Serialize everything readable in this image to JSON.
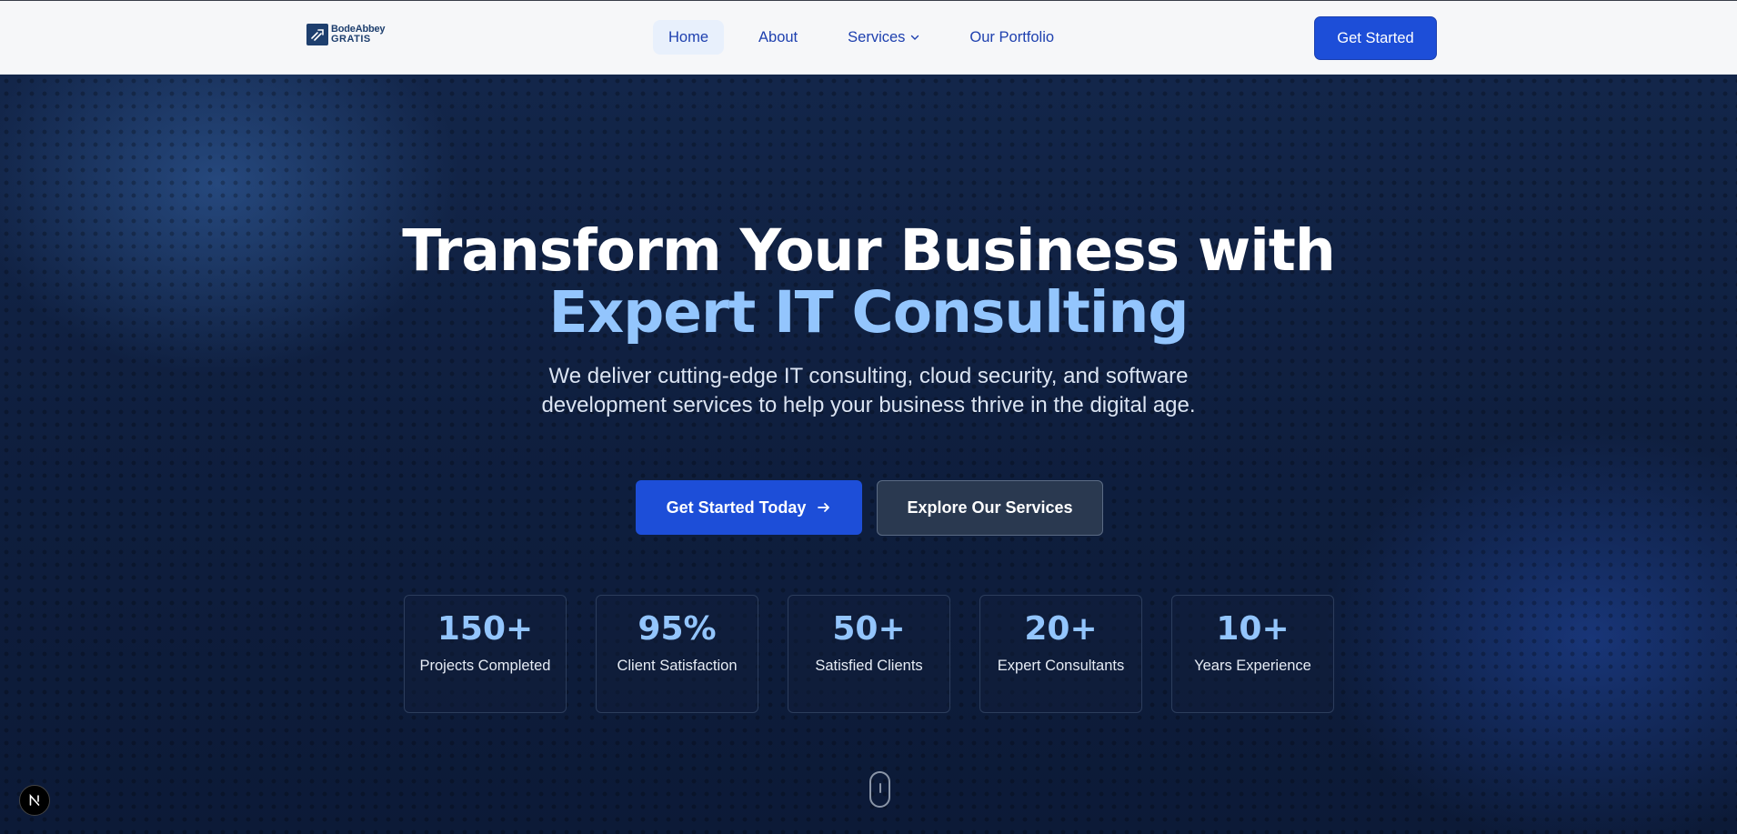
{
  "header": {
    "logo": {
      "line1": "BodeAbbey",
      "line2": "GRATIS"
    },
    "nav": [
      {
        "label": "Home"
      },
      {
        "label": "About"
      },
      {
        "label": "Services"
      },
      {
        "label": "Our Portfolio"
      }
    ],
    "cta_label": "Get Started"
  },
  "hero": {
    "title_line1": "Transform Your Business with",
    "title_line2": "Expert IT Consulting",
    "subtitle": "We deliver cutting-edge IT consulting, cloud security, and software development services to help your business thrive in the digital age.",
    "primary_button": "Get Started Today",
    "secondary_button": "Explore Our Services",
    "stats": [
      {
        "value": "150+",
        "label": "Projects Completed"
      },
      {
        "value": "95%",
        "label": "Client Satisfaction"
      },
      {
        "value": "50+",
        "label": "Satisfied Clients"
      },
      {
        "value": "20+",
        "label": "Expert Consultants"
      },
      {
        "value": "10+",
        "label": "Years Experience"
      }
    ]
  },
  "dev_badge": {
    "letter": "N"
  },
  "colors": {
    "primary": "#1d4ed8",
    "accent": "#93c5fd",
    "nav_text": "#1e40af",
    "hero_bg": "#0f1f3f"
  },
  "icons": {
    "services_dropdown": "chevron-down-icon",
    "primary_button": "arrow-right-icon"
  }
}
